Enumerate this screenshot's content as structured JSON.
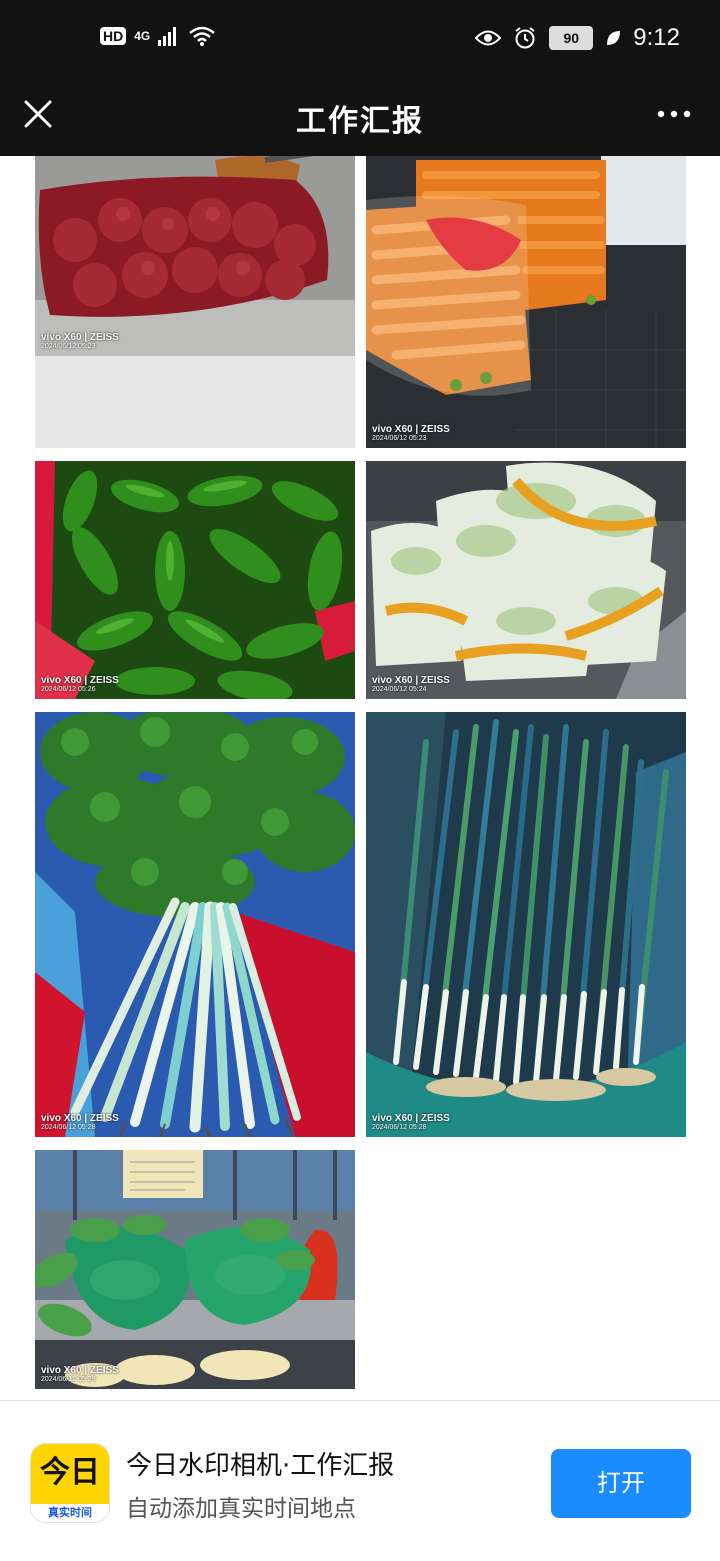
{
  "status_bar": {
    "hd_label": "HD",
    "network": "4G",
    "battery": "90",
    "time": "9:12"
  },
  "nav": {
    "title": "工作汇报",
    "close_icon": "close-icon",
    "more_icon": "more-icon"
  },
  "photos": [
    {
      "subject": "onions",
      "watermark_brand": "vivo X60 | ZEISS",
      "watermark_date": "2024/06/12 05:23"
    },
    {
      "subject": "carrots",
      "watermark_brand": "vivo X60 | ZEISS",
      "watermark_date": "2024/06/12 05:23"
    },
    {
      "subject": "green peppers",
      "watermark_brand": "vivo X60 | ZEISS",
      "watermark_date": "2024/06/12 05:26"
    },
    {
      "subject": "bok choy",
      "watermark_brand": "vivo X60 | ZEISS",
      "watermark_date": "2024/06/12 05:24"
    },
    {
      "subject": "celery",
      "watermark_brand": "vivo X60 | ZEISS",
      "watermark_date": "2024/06/12 05:28"
    },
    {
      "subject": "green onions",
      "watermark_brand": "vivo X60 | ZEISS",
      "watermark_date": "2024/06/12 05:28"
    },
    {
      "subject": "leafy greens in bags",
      "watermark_brand": "vivo X60 | ZEISS",
      "watermark_date": "2024/06/12 05:29"
    }
  ],
  "promo": {
    "app_icon_top": "今日",
    "app_icon_bottom": "真实时间",
    "title": "今日水印相机·工作汇报",
    "subtitle": "自动添加真实时间地点",
    "open_label": "打开",
    "button_color": "#1a8cff"
  }
}
